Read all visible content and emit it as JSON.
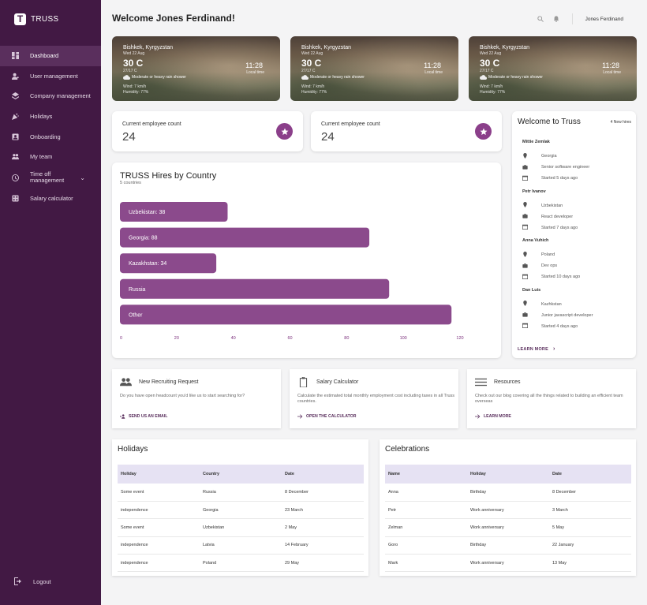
{
  "brand": {
    "name": "TRUSS",
    "logo_letter": "T"
  },
  "sidebar": {
    "items": [
      {
        "label": "Dashboard",
        "icon": "dashboard-icon",
        "active": true
      },
      {
        "label": "User management",
        "icon": "user-management-icon"
      },
      {
        "label": "Company management",
        "icon": "layers-icon"
      },
      {
        "label": "Holidays",
        "icon": "party-icon"
      },
      {
        "label": "Onboarding",
        "icon": "onboarding-icon"
      },
      {
        "label": "My team",
        "icon": "team-icon"
      },
      {
        "label": "Time off management",
        "icon": "clock-icon",
        "expandable": true
      },
      {
        "label": "Salary calculator",
        "icon": "calculator-icon"
      }
    ],
    "logout_label": "Logout"
  },
  "header": {
    "welcome": "Welcome Jones Ferdinand!",
    "user_name": "Jones Ferdinand"
  },
  "weather": [
    {
      "city": "Bishkek, Kyrgyzstan",
      "date": "Wed 22 Aug",
      "temp": "30 C",
      "feels": "27/17 C",
      "condition": "Moderate or heavy rain shower",
      "wind": "Wind: 7 km/h",
      "humidity": "Humidity: 77%",
      "local_time": "11:28",
      "local_time_label": "Local time"
    },
    {
      "city": "Bishkek, Kyrgyzstan",
      "date": "Wed 22 Aug",
      "temp": "30 C",
      "feels": "27/17 C",
      "condition": "Moderate or heavy rain shower",
      "wind": "Wind: 7 km/h",
      "humidity": "Humidity: 77%",
      "local_time": "11:28",
      "local_time_label": "Local time"
    },
    {
      "city": "Bishkek, Kyrgyzstan",
      "date": "Wed 22 Aug",
      "temp": "30 C",
      "feels": "27/17 C",
      "condition": "Moderate or heavy rain shower",
      "wind": "Wind: 7 km/h",
      "humidity": "Humidity: 77%",
      "local_time": "11:28",
      "local_time_label": "Local time"
    }
  ],
  "employee_cards": [
    {
      "label": "Current employee count",
      "value": "24"
    },
    {
      "label": "Current employee count",
      "value": "24"
    }
  ],
  "chart_data": {
    "type": "bar",
    "orientation": "horizontal",
    "title": "TRUSS Hires by Country",
    "subtitle": "5 countries",
    "categories": [
      "Uzbekistan",
      "Georgia",
      "Kazakhstan",
      "Russia",
      "Other"
    ],
    "bar_labels": [
      "Uzbekistan: 38",
      "Georgia: 88",
      "Kazakhstan: 34",
      "Russia",
      "Other"
    ],
    "values": [
      38,
      88,
      34,
      95,
      117
    ],
    "xlim": [
      0,
      120
    ],
    "xticks": [
      0,
      20,
      40,
      60,
      80,
      100,
      120
    ],
    "bar_color": "#8b4a8c",
    "grid": false
  },
  "welcome_panel": {
    "title": "Welcome to Truss",
    "badge": "4 New hires",
    "hires": [
      {
        "name": "Mittie Zemlak",
        "country": "Georgia",
        "role": "Senior software engineer",
        "started": "Started 5 days ago"
      },
      {
        "name": "Petr Ivanov",
        "country": "Uzbekistan",
        "role": "React developer",
        "started": "Started 7 days ago"
      },
      {
        "name": "Anna Vuhich",
        "country": "Poland",
        "role": "Dev ops",
        "started": "Started 10 days ago"
      },
      {
        "name": "Dan Luis",
        "country": "Kazhkstan",
        "role": "Junior javascript developer",
        "started": "Started 4 days ago"
      }
    ],
    "learn_more": "LEARN MORE"
  },
  "quick_cards": [
    {
      "title": "New Recruiting Request",
      "icon": "group-icon",
      "description": "Do you have open headcount you'd like us to start searching for?",
      "link": "SEND US AN EMAIL",
      "link_icon": "add-person-icon"
    },
    {
      "title": "Salary Calculator",
      "icon": "clipboard-icon",
      "description": "Calculate the estimated total monthly employment cost including taxes in all Truss countries.",
      "link": "OPEN THE CALCULATOR",
      "link_icon": "arrow-right-icon"
    },
    {
      "title": "Resources",
      "icon": "menu-lines-icon",
      "description": "Check out our blog covering all the things related to building an efficient team overseas",
      "link": "LEARN MORE",
      "link_icon": "arrow-right-icon"
    }
  ],
  "holidays": {
    "title": "Holidays",
    "columns": [
      "Holiday",
      "Country",
      "Date"
    ],
    "rows": [
      [
        "Some event",
        "Russia",
        "8 December"
      ],
      [
        "independence",
        "Georgia",
        "23 March"
      ],
      [
        "Some event",
        "Uzbekistan",
        "2 May"
      ],
      [
        "independence",
        "Latvia",
        "14 February"
      ],
      [
        "independence",
        "Poland",
        "29 May"
      ]
    ]
  },
  "celebrations": {
    "title": "Celebrations",
    "columns": [
      "Name",
      "Holiday",
      "Date"
    ],
    "rows": [
      [
        "Anna",
        "Birthday",
        "8 December"
      ],
      [
        "Petr",
        "Work anniversary",
        "3 March"
      ],
      [
        "Zelman",
        "Work anniversary",
        "5 May"
      ],
      [
        "Goro",
        "Birthday",
        "22 January"
      ],
      [
        "Mark",
        "Work anniversary",
        "13 May"
      ]
    ]
  }
}
